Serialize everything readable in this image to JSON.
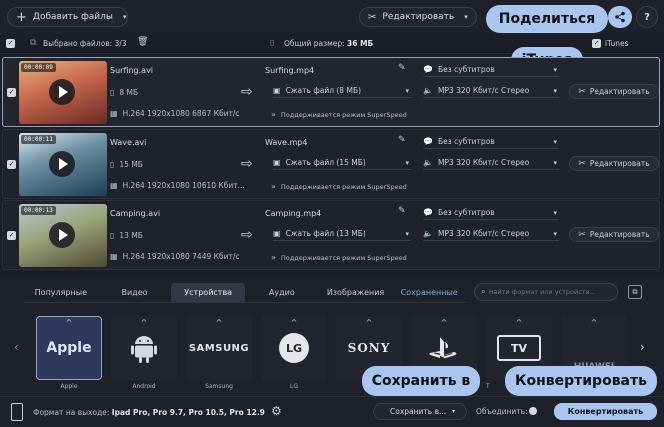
{
  "toolbar": {
    "add_files_label": "Добавить файлы",
    "edit_label": "Редактировать",
    "share_label": "Поделиться",
    "help_label": "?",
    "itunes_callout": "iTunes",
    "itunes_label": "iTunes"
  },
  "selection": {
    "selected_label": "Выбрано файлов: 3/3",
    "total_size_label": "Общий размер:",
    "total_size_value": "36 МБ"
  },
  "files": [
    {
      "timecode": "00:00:09",
      "source_name": "Surfing.avi",
      "source_size": "8 МБ",
      "source_codec": "H.264 1920x1080 6867 Кбит/с",
      "output_name": "Surfing.mp4",
      "compress_label": "Сжать файл (8 МБ)",
      "superspeed_label": "Поддерживается режим SuperSpeed",
      "subtitles_label": "Без субтитров",
      "audio_label": "MP3 320 Кбит/с Стерео",
      "edit_label": "Редактировать"
    },
    {
      "timecode": "00:00:11",
      "source_name": "Wave.avi",
      "source_size": "15 МБ",
      "source_codec": "H.264 1920x1080 10610 Кбит...",
      "output_name": "Wave.mp4",
      "compress_label": "Сжать файл (15 МБ)",
      "superspeed_label": "Поддерживается режим SuperSpeed",
      "subtitles_label": "Без субтитров",
      "audio_label": "MP3 320 Кбит/с Стерео",
      "edit_label": "Редактировать"
    },
    {
      "timecode": "00:00:13",
      "source_name": "Camping.avi",
      "source_size": "13 МБ",
      "source_codec": "H.264 1920x1080 7449 Кбит/с",
      "output_name": "Camping.mp4",
      "compress_label": "Сжать файл (13 МБ)",
      "superspeed_label": "Поддерживается режим SuperSpeed",
      "subtitles_label": "Без субтитров",
      "audio_label": "MP3 320 Кбит/с Стерео",
      "edit_label": "Редактировать"
    }
  ],
  "format_tabs": [
    "Популярные",
    "Видео",
    "Устройства",
    "Аудио",
    "Изображения",
    "Сохраненные"
  ],
  "active_tab": "Устройства",
  "search": {
    "placeholder": "Найти формат или устройств..."
  },
  "devices": [
    {
      "label": "Apple",
      "logo": "Apple"
    },
    {
      "label": "Android",
      "logo": "android-robot"
    },
    {
      "label": "Samsung",
      "logo": "SAMSUNG"
    },
    {
      "label": "LG",
      "logo": "LG"
    },
    {
      "label": "",
      "logo": "SONY"
    },
    {
      "label": "",
      "logo": "playstation"
    },
    {
      "label": "Т",
      "logo": "TV"
    },
    {
      "label": "",
      "logo": "HUAWEI"
    }
  ],
  "bottom": {
    "output_format_label": "Формат на выходе:",
    "output_format_value": "Ipad Pro, Pro 9.7, Pro 10.5, Pro 12.9",
    "save_to_label": "Сохранить в...",
    "save_to_callout": "Сохранить в",
    "merge_label": "Объединить:",
    "convert_label": "Конвертировать",
    "convert_callout": "Конвертировать"
  },
  "colors": {
    "accent": "#a9c6f0",
    "background": "#1b1e26",
    "active_tab": "#343845"
  }
}
